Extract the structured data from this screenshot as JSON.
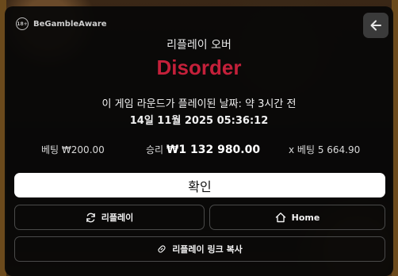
{
  "logo": {
    "badge_text": "18+",
    "text": "BeGambleAware"
  },
  "modal": {
    "subtitle": "리플레이 오버",
    "game_title": "Disorder",
    "played_text": "이 게임 라운드가 플레이된 날짜: 약 3시간 전",
    "datetime": "14일 11월 2025 05:36:12"
  },
  "stats": {
    "bet_label": "베팅",
    "bet_value": "₩200.00",
    "win_label": "승리",
    "win_value": "₩1 132 980.00",
    "mult_label": "x 베팅",
    "mult_value": "5 664.90"
  },
  "buttons": {
    "confirm": "확인",
    "replay": "리플레이",
    "home": "Home",
    "copy_link": "리플레이 링크 복사"
  },
  "colors": {
    "game_title": "#c4203a",
    "modal_bg": "#080808",
    "confirm_bg": "#ffffff"
  },
  "icons": {
    "back": "arrow-left-icon",
    "replay": "refresh-icon",
    "home": "home-icon",
    "copy": "link-icon"
  }
}
